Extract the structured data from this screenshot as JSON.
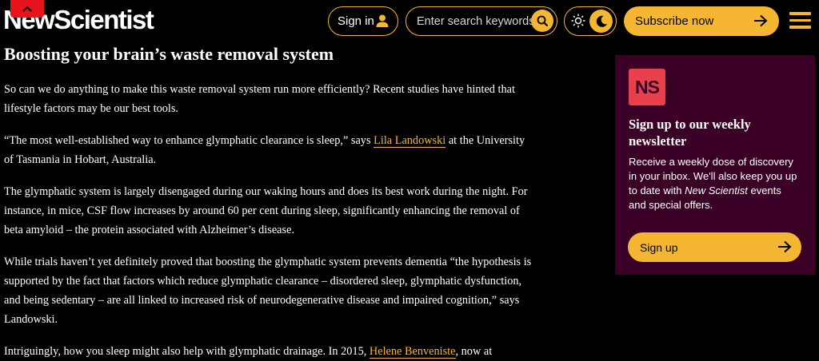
{
  "header": {
    "logo_text": "NewScientist",
    "signin_label": "Sign in",
    "search_placeholder": "Enter search keywords",
    "subscribe_label": "Subscribe now",
    "accent_color": "#f5b731"
  },
  "article": {
    "heading": "Boosting your brain’s waste removal system",
    "p1": "So can we do anything to make this waste removal system run more efficiently? Recent studies have hinted that lifestyle factors may be our best tools.",
    "p2_a": "“The most well-established way to enhance glymphatic clearance is sleep,” says ",
    "p2_link": "Lila Landowski",
    "p2_b": " at the University of Tasmania in Hobart, Australia.",
    "p3": "The glymphatic system is largely disengaged during our waking hours and does its best work during the night. For instance, in mice, CSF flow increases by around 60 per cent during sleep, significantly enhancing the removal of beta amyloid – the protein associated with Alzheimer’s disease.",
    "p4": "While trials haven’t yet definitely proved that boosting the glymphatic system prevents dementia “the hypothesis is supported by the fact that factors which reduce glymphatic clearance – disordered sleep, glymphatic dysfunction, and being sedentary – are all linked to increased risk of neurodegenerative disease and impaired cognition,” says Landowski.",
    "p5_a": "Intriguingly, how you sleep might also help with glymphatic drainage. In 2015, ",
    "p5_link": "Helene Benveniste",
    "p5_b": ", now at"
  },
  "newsletter": {
    "logo_text": "NS",
    "title": "Sign up to our weekly newsletter",
    "desc_a": "Receive a weekly dose of discovery in your inbox. We'll also keep you up to date with ",
    "desc_em": "New Scientist",
    "desc_b": " events and special offers.",
    "signup_label": "Sign up"
  }
}
